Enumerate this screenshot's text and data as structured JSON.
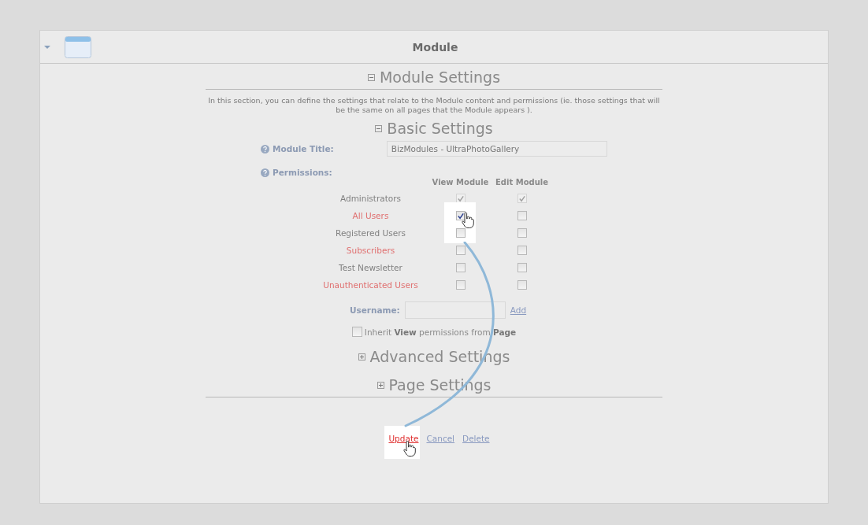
{
  "panel": {
    "title": "Module",
    "expanded": true
  },
  "module_settings": {
    "title": "Module Settings",
    "expanded": true,
    "description": "In this section, you can define the settings that relate to the Module content and permissions (ie. those settings that will be the same on all pages that the Module appears )."
  },
  "basic_settings": {
    "title": "Basic Settings",
    "expanded": true,
    "module_title_label": "Module Title:",
    "module_title_value": "BizModules - UltraPhotoGallery",
    "permissions_label": "Permissions:"
  },
  "permission_columns": [
    "View Module",
    "Edit Module"
  ],
  "permissions": [
    {
      "name": "Administrators",
      "color": "#808080",
      "view": {
        "checked": true,
        "disabled": true,
        "spotlight": false
      },
      "edit": {
        "checked": true,
        "disabled": true
      }
    },
    {
      "name": "All Users",
      "color": "#e07070",
      "view": {
        "checked": true,
        "disabled": false,
        "spotlight": true
      },
      "edit": {
        "checked": false,
        "disabled": false
      }
    },
    {
      "name": "Registered Users",
      "color": "#808080",
      "view": {
        "checked": false,
        "disabled": false,
        "spotlight": false
      },
      "edit": {
        "checked": false,
        "disabled": false
      }
    },
    {
      "name": "Subscribers",
      "color": "#e07070",
      "view": {
        "checked": false,
        "disabled": false,
        "spotlight": false
      },
      "edit": {
        "checked": false,
        "disabled": false
      }
    },
    {
      "name": "Test Newsletter",
      "color": "#808080",
      "view": {
        "checked": false,
        "disabled": false,
        "spotlight": false
      },
      "edit": {
        "checked": false,
        "disabled": false
      }
    },
    {
      "name": "Unauthenticated Users",
      "color": "#e07070",
      "view": {
        "checked": false,
        "disabled": false,
        "spotlight": false
      },
      "edit": {
        "checked": false,
        "disabled": false
      }
    }
  ],
  "username": {
    "label": "Username:",
    "add_link": "Add"
  },
  "inherit": {
    "checked": false,
    "text": "Inherit **View** permissions from **Page**"
  },
  "collapsed_sections": [
    {
      "title": "Advanced Settings",
      "expanded": false
    },
    {
      "title": "Page Settings",
      "expanded": false
    }
  ],
  "actions": [
    {
      "label": "Update",
      "spotlight": true
    },
    {
      "label": "Cancel",
      "spotlight": false
    },
    {
      "label": "Delete",
      "spotlight": false
    }
  ]
}
